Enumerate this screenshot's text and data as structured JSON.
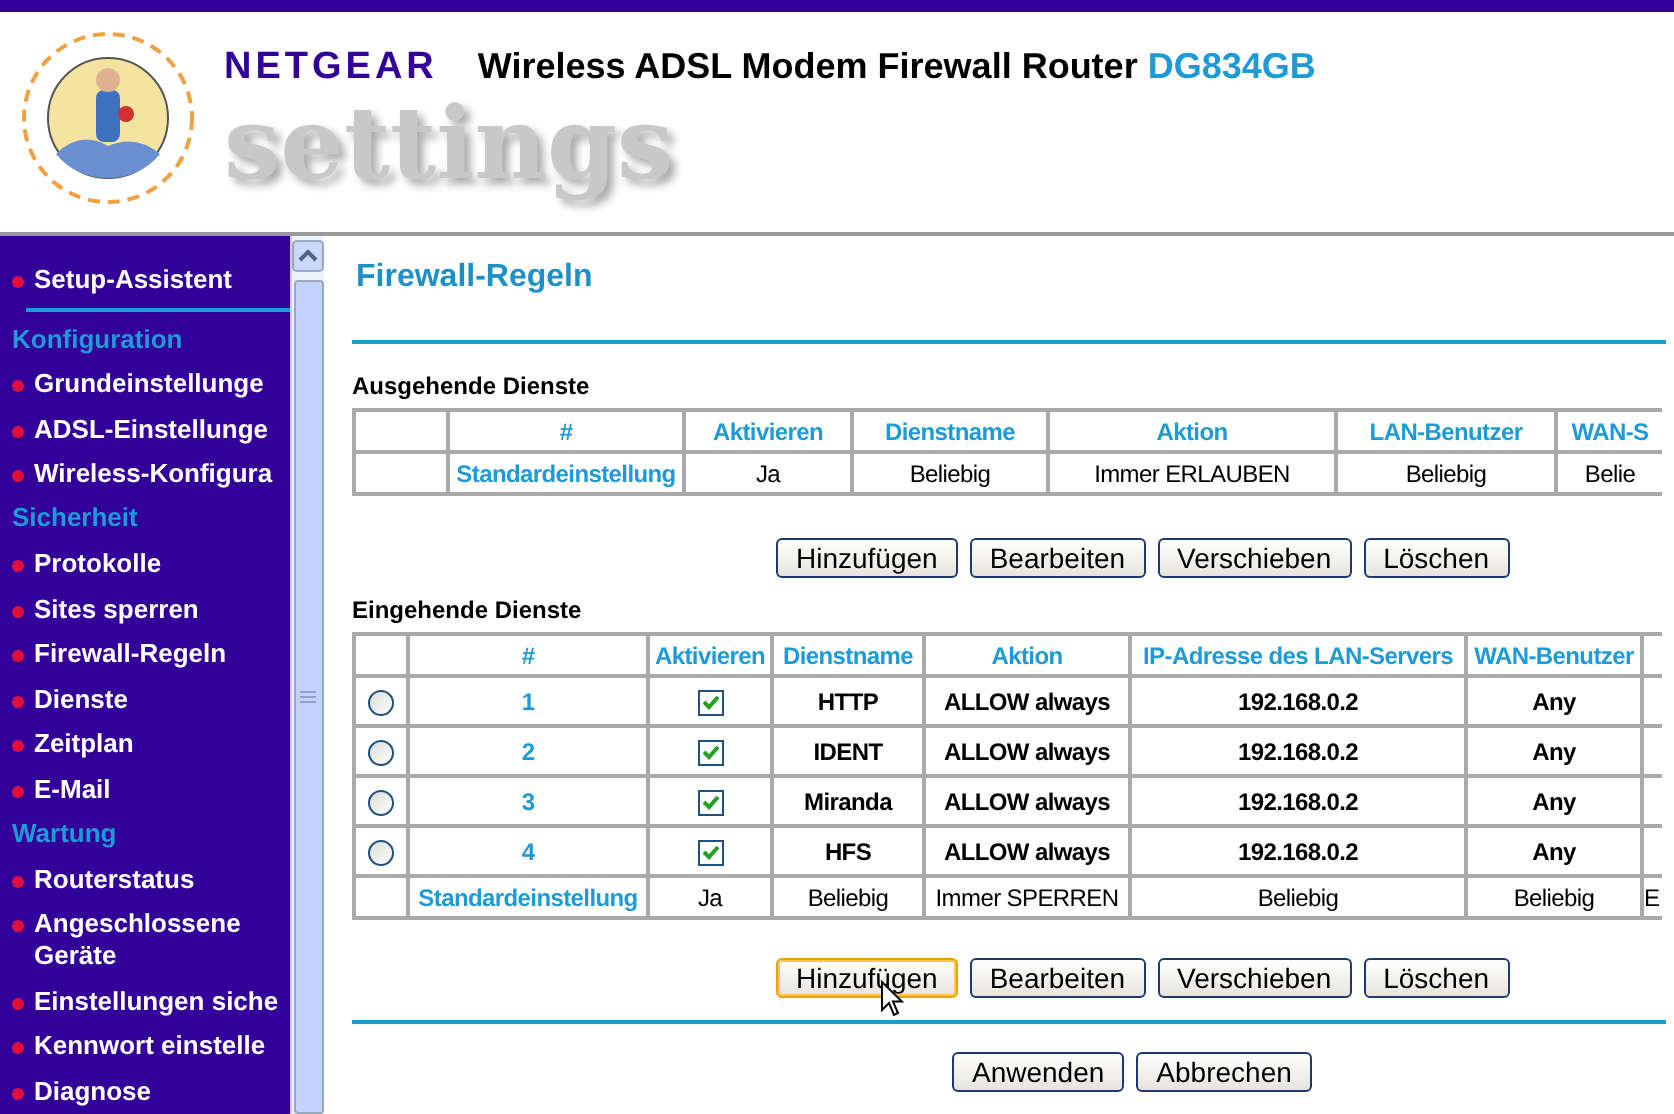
{
  "header": {
    "brand": "NETGEAR",
    "title": "Wireless ADSL Modem Firewall Router",
    "model": "DG834GB",
    "subtitle": "settings"
  },
  "sidebar": {
    "items": [
      {
        "kind": "link",
        "label": "Setup-Assistent"
      },
      {
        "kind": "divider"
      },
      {
        "kind": "section",
        "label": "Konfiguration"
      },
      {
        "kind": "link",
        "label": "Grundeinstellunge"
      },
      {
        "kind": "link",
        "label": "ADSL-Einstellunge"
      },
      {
        "kind": "link",
        "label": "Wireless-Konfigura"
      },
      {
        "kind": "section",
        "label": "Sicherheit"
      },
      {
        "kind": "link",
        "label": "Protokolle"
      },
      {
        "kind": "link",
        "label": "Sites sperren"
      },
      {
        "kind": "link",
        "label": "Firewall-Regeln"
      },
      {
        "kind": "link",
        "label": "Dienste"
      },
      {
        "kind": "link",
        "label": "Zeitplan"
      },
      {
        "kind": "link",
        "label": "E-Mail"
      },
      {
        "kind": "section",
        "label": "Wartung"
      },
      {
        "kind": "link",
        "label": "Routerstatus"
      },
      {
        "kind": "link",
        "label": "Angeschlossene Geräte"
      },
      {
        "kind": "link",
        "label": "Einstellungen siche"
      },
      {
        "kind": "link",
        "label": "Kennwort einstelle"
      },
      {
        "kind": "link",
        "label": "Diagnose"
      }
    ]
  },
  "page": {
    "title": "Firewall-Regeln",
    "outgoing": {
      "heading": "Ausgehende Dienste",
      "columns": [
        "",
        "#",
        "Aktivieren",
        "Dienstname",
        "Aktion",
        "LAN-Benutzer",
        "WAN-S"
      ],
      "rows": [
        {
          "cells": [
            "",
            "Standardeinstellung",
            "Ja",
            "Beliebig",
            "Immer ERLAUBEN",
            "Beliebig",
            "Belie"
          ]
        }
      ],
      "buttons": [
        {
          "label": "Hinzufügen",
          "focused": false
        },
        {
          "label": "Bearbeiten",
          "focused": false
        },
        {
          "label": "Verschieben",
          "focused": false
        },
        {
          "label": "Löschen",
          "focused": false
        }
      ]
    },
    "incoming": {
      "heading": "Eingehende Dienste",
      "columns": [
        "",
        "#",
        "Aktivieren",
        "Dienstname",
        "Aktion",
        "IP-Adresse des LAN-Servers",
        "WAN-Benutzer",
        ""
      ],
      "rows": [
        {
          "kind": "rule",
          "selected": false,
          "number": "1",
          "checked": true,
          "name": "HTTP",
          "action": "ALLOW always",
          "ip": "192.168.0.2",
          "wan": "Any"
        },
        {
          "kind": "rule",
          "selected": false,
          "number": "2",
          "checked": true,
          "name": "IDENT",
          "action": "ALLOW always",
          "ip": "192.168.0.2",
          "wan": "Any"
        },
        {
          "kind": "rule",
          "selected": false,
          "number": "3",
          "checked": true,
          "name": "Miranda",
          "action": "ALLOW always",
          "ip": "192.168.0.2",
          "wan": "Any"
        },
        {
          "kind": "rule",
          "selected": false,
          "number": "4",
          "checked": true,
          "name": "HFS",
          "action": "ALLOW always",
          "ip": "192.168.0.2",
          "wan": "Any"
        },
        {
          "kind": "default",
          "cells": [
            "",
            "Standardeinstellung",
            "Ja",
            "Beliebig",
            "Immer SPERREN",
            "Beliebig",
            "Beliebig",
            "E"
          ]
        }
      ],
      "buttons": [
        {
          "label": "Hinzufügen",
          "focused": true
        },
        {
          "label": "Bearbeiten",
          "focused": false
        },
        {
          "label": "Verschieben",
          "focused": false
        },
        {
          "label": "Löschen",
          "focused": false
        }
      ]
    },
    "footer_buttons": [
      {
        "label": "Anwenden",
        "focused": false
      },
      {
        "label": "Abbrechen",
        "focused": false
      }
    ]
  }
}
